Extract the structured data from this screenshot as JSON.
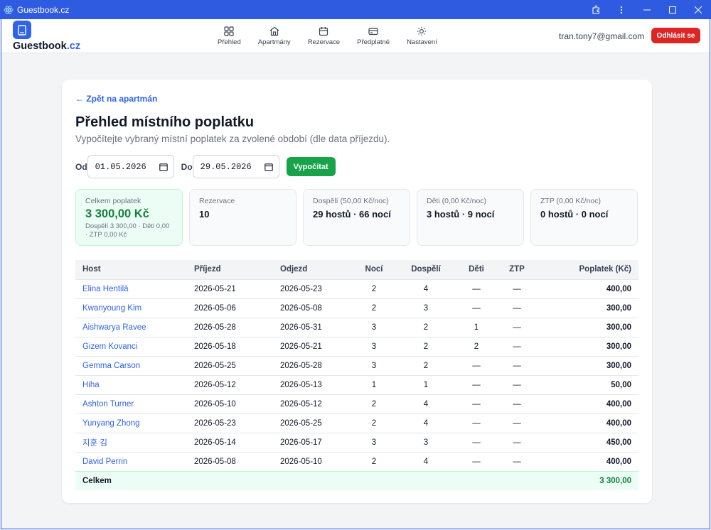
{
  "window": {
    "title": "Guestbook.cz"
  },
  "header": {
    "brand_name": "Guestbook",
    "brand_tld": ".cz",
    "nav": [
      {
        "label": "Přehled",
        "icon": "grid-icon"
      },
      {
        "label": "Apartmány",
        "icon": "home-icon"
      },
      {
        "label": "Rezervace",
        "icon": "calendar-icon"
      },
      {
        "label": "Předplatné",
        "icon": "credit-card-icon"
      },
      {
        "label": "Nastavení",
        "icon": "sun-gear-icon"
      }
    ],
    "user_email": "tran.tony7@gmail.com",
    "logout_label": "Odhlásit se"
  },
  "page": {
    "back_link": "← Zpět na apartmán",
    "title": "Přehled místního poplatku",
    "subtitle": "Vypočítejte vybraný místní poplatek za zvolené období (dle data příjezdu).",
    "from_label": "Od",
    "from_value": "01.05.2026",
    "to_label": "Do",
    "to_value": "29.05.2026",
    "calculate_label": "Vypočítat"
  },
  "stats": {
    "total_label": "Celkem poplatek",
    "total_value": "3 300,00 Kč",
    "total_note": "Dospělí 3 300,00 · Děti 0,00 · ZTP 0,00 Kč",
    "reservations_label": "Rezervace",
    "reservations_value": "10",
    "adults_label": "Dospělí (50,00 Kč/noc)",
    "adults_value": "29 hostů · 66 nocí",
    "children_label": "Děti (0,00 Kč/noc)",
    "children_value": "3 hostů · 9 nocí",
    "ztp_label": "ZTP (0,00 Kč/noc)",
    "ztp_value": "0 hostů · 0 nocí"
  },
  "table": {
    "headers": [
      "Host",
      "Příjezd",
      "Odjezd",
      "Nocí",
      "Dospělí",
      "Děti",
      "ZTP",
      "Poplatek (Kč)"
    ],
    "rows": [
      [
        "Elina Hentilä",
        "2026-05-21",
        "2026-05-23",
        "2",
        "4",
        "—",
        "—",
        "400,00"
      ],
      [
        "Kwanyoung Kim",
        "2026-05-06",
        "2026-05-08",
        "2",
        "3",
        "—",
        "—",
        "300,00"
      ],
      [
        "Aishwarya Ravee",
        "2026-05-28",
        "2026-05-31",
        "3",
        "2",
        "1",
        "—",
        "300,00"
      ],
      [
        "Gizem Kovanci",
        "2026-05-18",
        "2026-05-21",
        "3",
        "2",
        "2",
        "—",
        "300,00"
      ],
      [
        "Gemma Carson",
        "2026-05-25",
        "2026-05-28",
        "3",
        "2",
        "—",
        "—",
        "300,00"
      ],
      [
        "Hiha",
        "2026-05-12",
        "2026-05-13",
        "1",
        "1",
        "—",
        "—",
        "50,00"
      ],
      [
        "Ashton Turner",
        "2026-05-10",
        "2026-05-12",
        "2",
        "4",
        "—",
        "—",
        "400,00"
      ],
      [
        "Yunyang Zhong",
        "2026-05-23",
        "2026-05-25",
        "2",
        "4",
        "—",
        "—",
        "400,00"
      ],
      [
        "지훈 김",
        "2026-05-14",
        "2026-05-17",
        "3",
        "3",
        "—",
        "—",
        "450,00"
      ],
      [
        "David Perrin",
        "2026-05-08",
        "2026-05-10",
        "2",
        "4",
        "—",
        "—",
        "400,00"
      ]
    ],
    "total_label": "Celkem",
    "total_value": "3 300,00"
  },
  "colors": {
    "accent": "#2f64e8",
    "success": "#16a34a",
    "danger": "#dc2626",
    "titlebar": "#2f5be0"
  }
}
